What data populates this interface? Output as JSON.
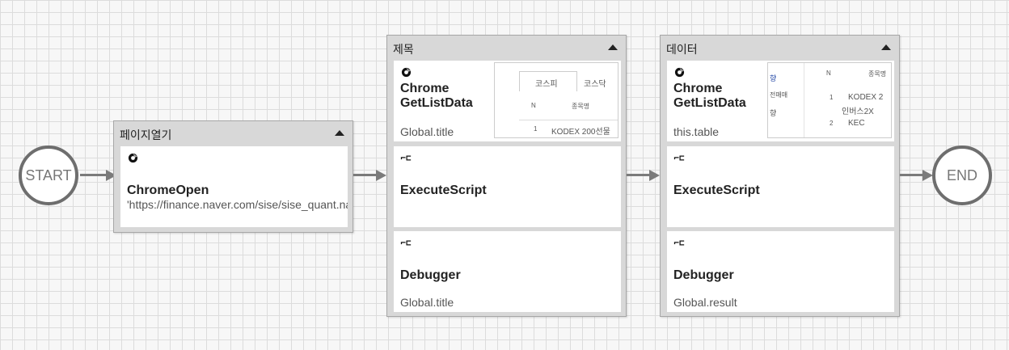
{
  "start_label": "START",
  "end_label": "END",
  "groups": [
    {
      "title": "페이지열기",
      "cards": [
        {
          "icon": "chrome-icon",
          "name": "ChromeOpen",
          "detail": "'https://finance.naver.com/sise/sise_quant.naver'"
        }
      ]
    },
    {
      "title": "제목",
      "cards": [
        {
          "icon": "chrome-icon",
          "name": "Chrome GetListData",
          "detail": "Global.title",
          "thumbnail": {
            "tabs": [
              "코스피",
              "코스닥"
            ],
            "headers": [
              "N",
              "종목명"
            ],
            "row": [
              "1",
              "KODEX 200선물"
            ]
          }
        },
        {
          "icon": "script-icon",
          "name": "ExecuteScript",
          "detail": ""
        },
        {
          "icon": "script-icon",
          "name": "Debugger",
          "detail": "Global.title"
        }
      ]
    },
    {
      "title": "데이터",
      "cards": [
        {
          "icon": "chrome-icon",
          "name": "Chrome GetListData",
          "detail": "this.table",
          "thumbnail": {
            "left": [
              "향",
              "전매매",
              "향"
            ],
            "headers": [
              "N",
              "종목명"
            ],
            "rows": [
              [
                "1",
                "KODEX 2",
                "인버스2X"
              ],
              [
                "2",
                "KEC",
                ""
              ]
            ]
          }
        },
        {
          "icon": "script-icon",
          "name": "ExecuteScript",
          "detail": ""
        },
        {
          "icon": "script-icon",
          "name": "Debugger",
          "detail": "Global.result"
        }
      ]
    }
  ]
}
